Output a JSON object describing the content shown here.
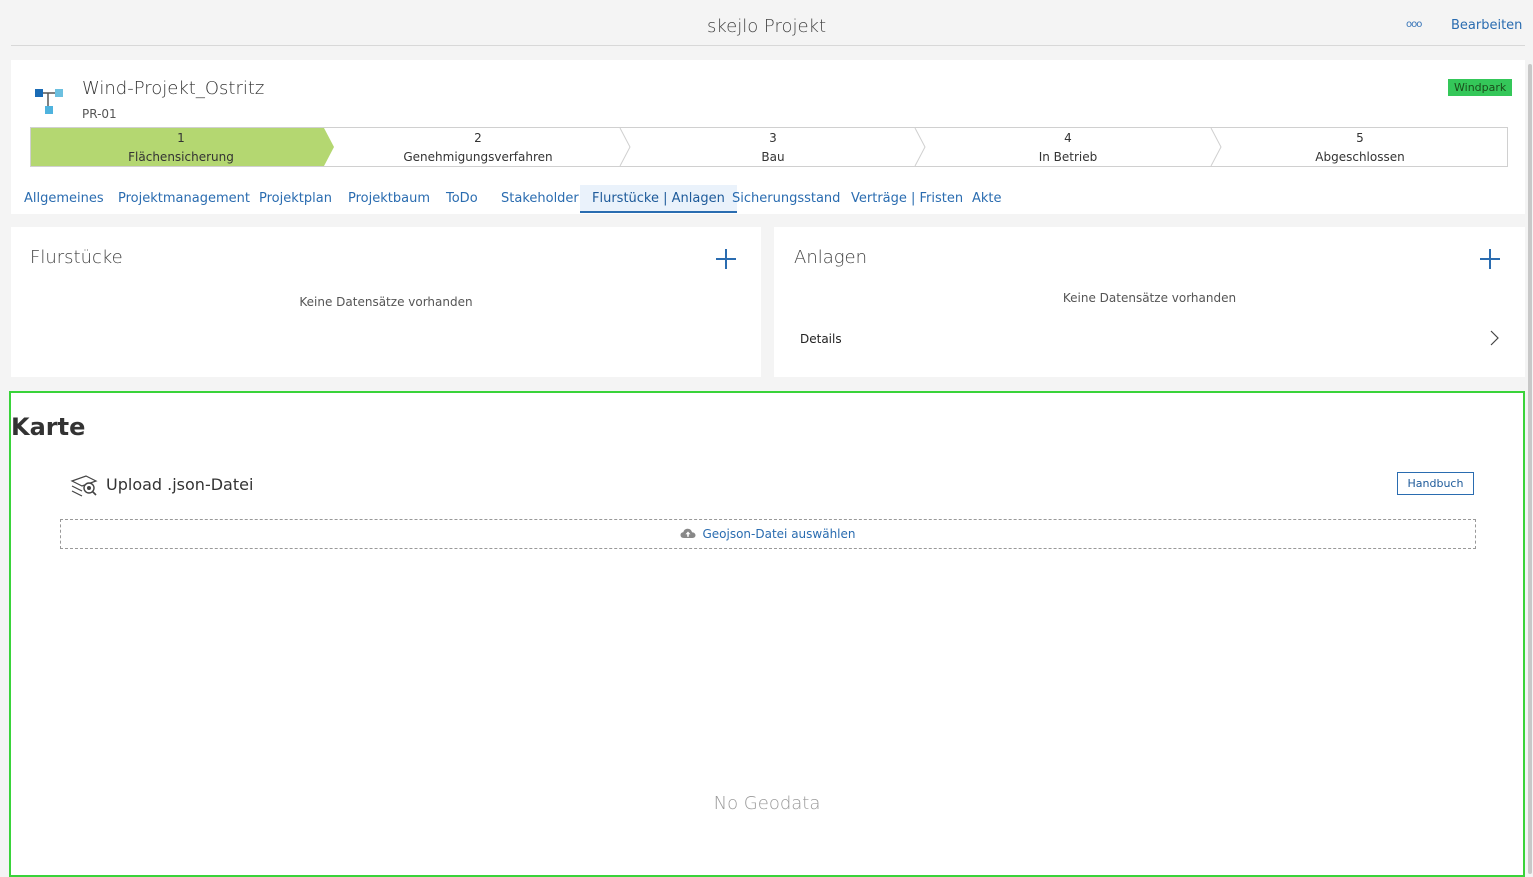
{
  "header": {
    "title": "skejlo Projekt",
    "more_label": "ooo",
    "edit_label": "Bearbeiten"
  },
  "project": {
    "name": "Wind-Projekt_Ostritz",
    "id": "PR-01",
    "badge": "Windpark",
    "badge_color": "#34c759"
  },
  "steps": [
    {
      "num": "1",
      "label": "Flächensicherung",
      "active": true
    },
    {
      "num": "2",
      "label": "Genehmigungsverfahren",
      "active": false
    },
    {
      "num": "3",
      "label": "Bau",
      "active": false
    },
    {
      "num": "4",
      "label": "In Betrieb",
      "active": false
    },
    {
      "num": "5",
      "label": "Abgeschlossen",
      "active": false
    }
  ],
  "tabs": [
    {
      "label": "Allgemeines"
    },
    {
      "label": "Projektmanagement"
    },
    {
      "label": "Projektplan"
    },
    {
      "label": "Projektbaum"
    },
    {
      "label": "ToDo"
    },
    {
      "label": "Stakeholder"
    },
    {
      "label": "Flurstücke | Anlagen",
      "active": true
    },
    {
      "label": "Sicherungsstand"
    },
    {
      "label": "Verträge | Fristen"
    },
    {
      "label": "Akte"
    }
  ],
  "flurstuecke": {
    "title": "Flurstücke",
    "empty": "Keine Datensätze vorhanden"
  },
  "anlagen": {
    "title": "Anlagen",
    "empty": "Keine Datensätze vorhanden",
    "details_label": "Details"
  },
  "map": {
    "title": "Karte",
    "upload_title": "Upload .json-Datei",
    "handbook_label": "Handbuch",
    "select_label": "Geojson-Datei auswählen",
    "empty": "No Geodata"
  },
  "colors": {
    "accent": "#2a6cb0",
    "active_step": "#b4d771",
    "highlight_border": "#39d33a"
  }
}
